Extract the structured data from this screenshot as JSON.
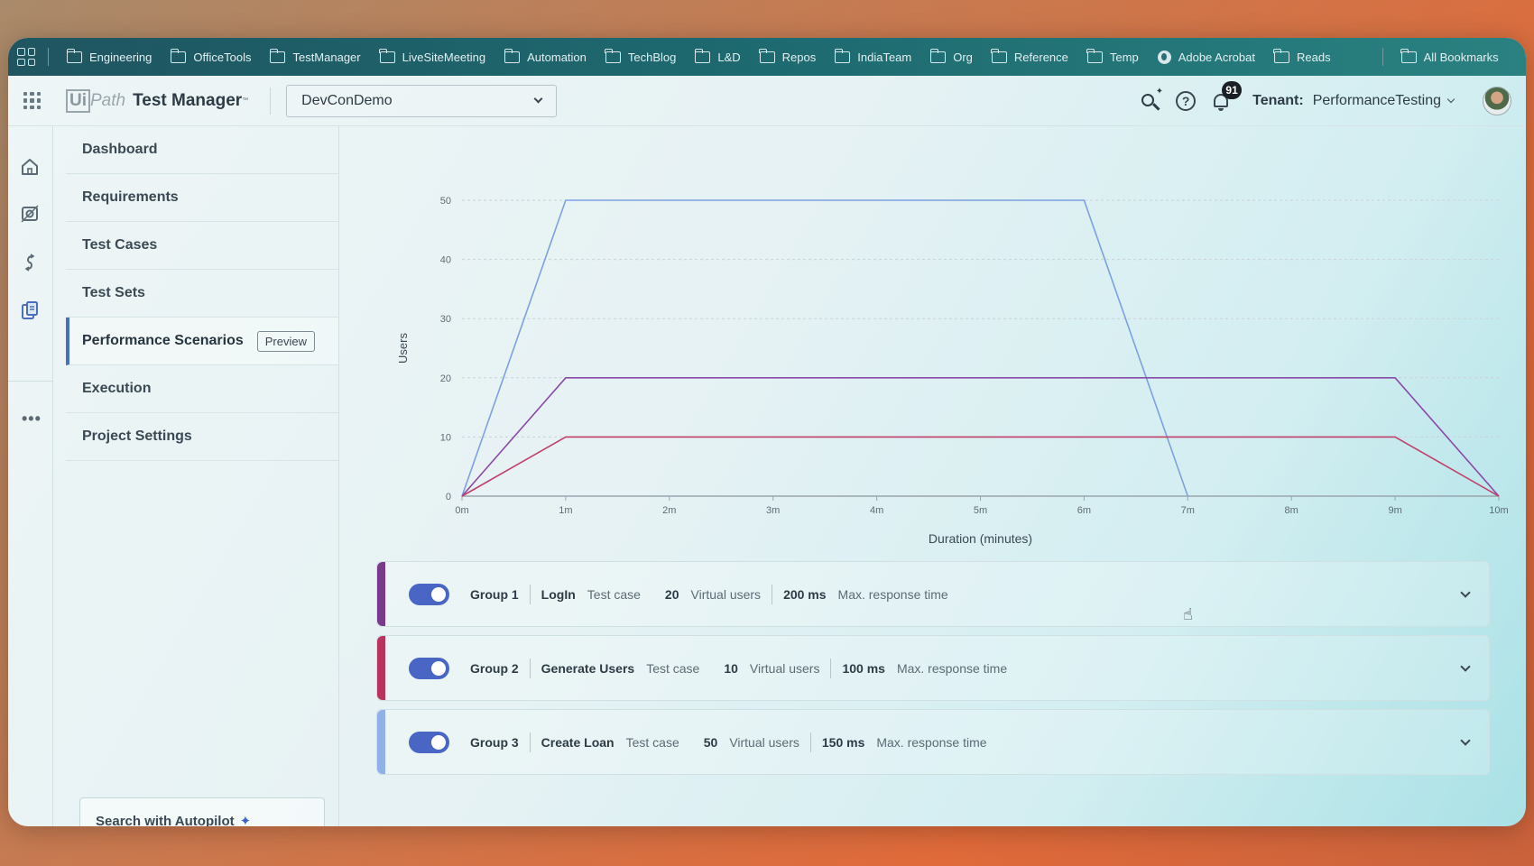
{
  "bookmarks": [
    {
      "label": "Engineering",
      "icon": "folder"
    },
    {
      "label": "OfficeTools",
      "icon": "folder"
    },
    {
      "label": "TestManager",
      "icon": "folder"
    },
    {
      "label": "LiveSiteMeeting",
      "icon": "folder"
    },
    {
      "label": "Automation",
      "icon": "folder"
    },
    {
      "label": "TechBlog",
      "icon": "folder"
    },
    {
      "label": "L&D",
      "icon": "folder"
    },
    {
      "label": "Repos",
      "icon": "folder"
    },
    {
      "label": "IndiaTeam",
      "icon": "folder"
    },
    {
      "label": "Org",
      "icon": "folder"
    },
    {
      "label": "Reference",
      "icon": "folder"
    },
    {
      "label": "Temp",
      "icon": "folder"
    },
    {
      "label": "Adobe Acrobat",
      "icon": "globe"
    },
    {
      "label": "Reads",
      "icon": "folder"
    }
  ],
  "all_bookmarks_label": "All Bookmarks",
  "header": {
    "logo_ui": "Ui",
    "logo_path": "Path",
    "product_name": "Test Manager",
    "project": "DevConDemo",
    "notification_count": "91",
    "tenant_label": "Tenant:",
    "tenant_value": "PerformanceTesting"
  },
  "nav": {
    "items": [
      {
        "label": "Dashboard"
      },
      {
        "label": "Requirements"
      },
      {
        "label": "Test Cases"
      },
      {
        "label": "Test Sets"
      },
      {
        "label": "Performance Scenarios",
        "badge": "Preview",
        "active": true
      },
      {
        "label": "Execution"
      },
      {
        "label": "Project Settings"
      }
    ],
    "autopilot_label": "Search with Autopilot"
  },
  "chart_data": {
    "type": "line",
    "xlabel": "Duration (minutes)",
    "ylabel": "Users",
    "x_ticks": [
      "0m",
      "1m",
      "2m",
      "3m",
      "4m",
      "5m",
      "6m",
      "7m",
      "8m",
      "9m",
      "10m"
    ],
    "xlim": [
      0,
      10
    ],
    "ylim": [
      0,
      50
    ],
    "y_ticks": [
      0,
      10,
      20,
      30,
      40,
      50
    ],
    "grid": true,
    "series": [
      {
        "color": "#7ba1e0",
        "points": [
          [
            0,
            0
          ],
          [
            1,
            50
          ],
          [
            6,
            50
          ],
          [
            7,
            0
          ]
        ]
      },
      {
        "color": "#8a4aa8",
        "points": [
          [
            0,
            0
          ],
          [
            1,
            20
          ],
          [
            9,
            20
          ],
          [
            10,
            0
          ]
        ]
      },
      {
        "color": "#c0406a",
        "points": [
          [
            0,
            0
          ],
          [
            1,
            10
          ],
          [
            9,
            10
          ],
          [
            10,
            0
          ]
        ]
      }
    ]
  },
  "groups": [
    {
      "name": "Group 1",
      "test_case": "LogIn",
      "test_case_label": "Test case",
      "users": "20",
      "users_label": "Virtual users",
      "response": "200 ms",
      "response_label": "Max. response time",
      "color": "#7a3a8c"
    },
    {
      "name": "Group 2",
      "test_case": "Generate Users",
      "test_case_label": "Test case",
      "users": "10",
      "users_label": "Virtual users",
      "response": "100 ms",
      "response_label": "Max. response time",
      "color": "#b8345c"
    },
    {
      "name": "Group 3",
      "test_case": "Create Loan",
      "test_case_label": "Test case",
      "users": "50",
      "users_label": "Virtual users",
      "response": "150 ms",
      "response_label": "Max. response time",
      "color": "#8fb0e8"
    }
  ]
}
